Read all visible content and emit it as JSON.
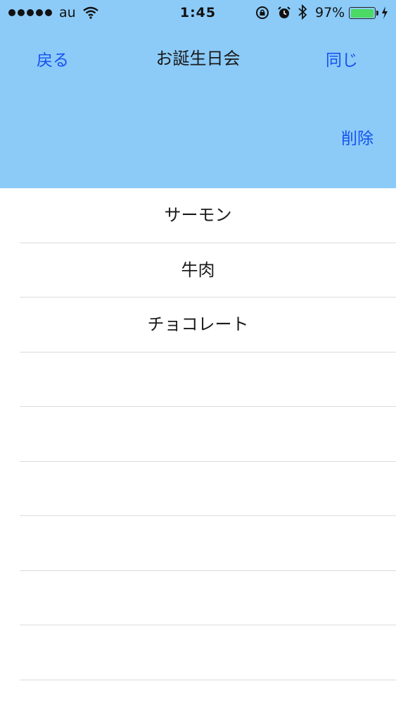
{
  "status_bar": {
    "carrier": "au",
    "time": "1:45",
    "battery_percent": "97%",
    "battery_level": 0.97,
    "battery_color": "#4cd964",
    "icons": [
      "signal-dots",
      "wifi-icon",
      "orientation-lock-icon",
      "alarm-icon",
      "bluetooth-icon",
      "battery-icon",
      "charging-bolt-icon"
    ]
  },
  "nav": {
    "back_label": "戻る",
    "title": "お誕生日会",
    "same_label": "同じ",
    "delete_label": "削除",
    "background_color": "#8ccbf8",
    "accent_color": "#1652f0"
  },
  "list": {
    "items": [
      {
        "label": "サーモン"
      },
      {
        "label": "牛肉"
      },
      {
        "label": "チョコレート"
      },
      {
        "label": ""
      },
      {
        "label": ""
      },
      {
        "label": ""
      },
      {
        "label": ""
      },
      {
        "label": ""
      },
      {
        "label": ""
      }
    ]
  }
}
